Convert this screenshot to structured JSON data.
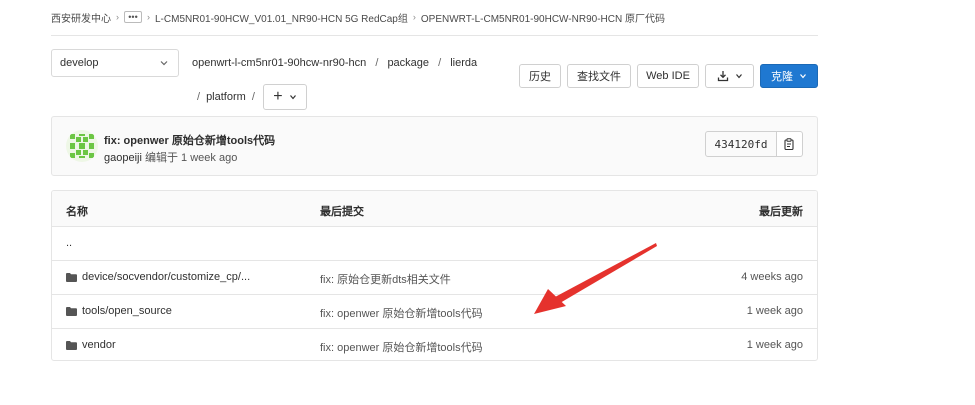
{
  "breadcrumb": {
    "items": [
      "西安研发中心",
      "L-CM5NR01-90HCW_V01.01_NR90-HCN 5G RedCap组",
      "OPENWRT-L-CM5NR01-90HCW-NR90-HCN 原厂代码"
    ],
    "ellipsis": "•••",
    "separator": "›"
  },
  "branch": {
    "selected": "develop"
  },
  "path": {
    "segments": [
      "openwrt-l-cm5nr01-90hcw-nr90-hcn",
      "package",
      "lierda",
      "platform"
    ],
    "separator": "/",
    "add_label": "+"
  },
  "toolbar": {
    "history_label": "历史",
    "find_file_label": "查找文件",
    "web_ide_label": "Web IDE",
    "clone_label": "克隆"
  },
  "commit": {
    "title": "fix: openwer 原始仓新增tools代码",
    "author": "gaopeiji",
    "edited_label": "编辑于",
    "time": "1 week ago",
    "sha": "434120fd"
  },
  "table": {
    "headers": {
      "name": "名称",
      "last_commit": "最后提交",
      "last_update": "最后更新"
    },
    "parent": "..",
    "rows": [
      {
        "name": "device/socvendor/customize_cp/...",
        "message": "fix: 原始仓更新dts相关文件",
        "time": "4 weeks ago",
        "icon": "folder-icon"
      },
      {
        "name": "tools/open_source",
        "message": "fix: openwer 原始仓新增tools代码",
        "time": "1 week ago",
        "icon": "folder-icon"
      },
      {
        "name": "vendor",
        "message": "fix: openwer 原始仓新增tools代码",
        "time": "1 week ago",
        "icon": "folder-icon"
      }
    ]
  },
  "colors": {
    "primary": "#1f78d1",
    "annotation_arrow": "#e5322d",
    "border": "#e5e5e5"
  }
}
